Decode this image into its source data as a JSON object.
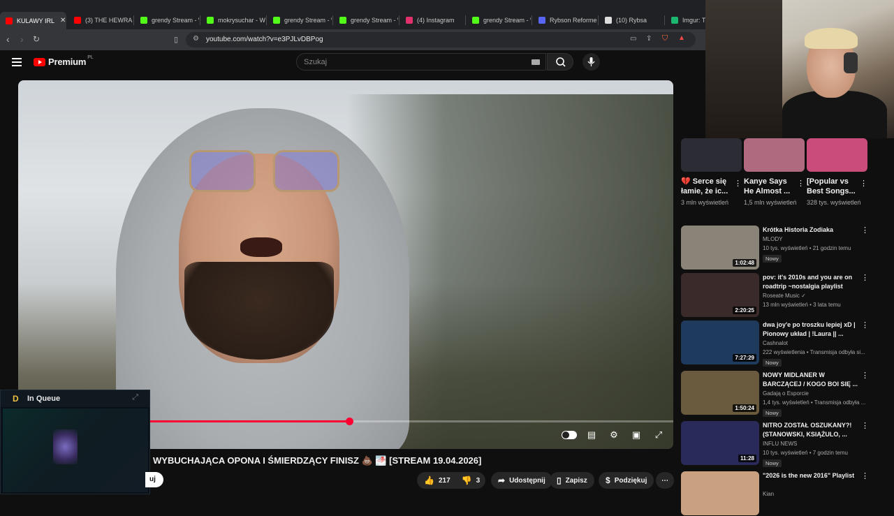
{
  "browser": {
    "tabs": [
      {
        "label": "KULAWY IRL",
        "active": true,
        "color": "#ff0000"
      },
      {
        "label": "(3) THE HEWRA",
        "active": false,
        "color": "#ff0000"
      },
      {
        "label": "grendy Stream - \\",
        "active": false,
        "color": "#53fc18"
      },
      {
        "label": "mokrysuchar - W",
        "active": false,
        "color": "#53fc18"
      },
      {
        "label": "grendy Stream - \\",
        "active": false,
        "color": "#53fc18"
      },
      {
        "label": "grendy Stream - \\",
        "active": false,
        "color": "#53fc18"
      },
      {
        "label": "(4) Instagram",
        "active": false,
        "color": "#e1306c"
      },
      {
        "label": "grendy Stream - \\",
        "active": false,
        "color": "#53fc18"
      },
      {
        "label": "Rybson Reformer",
        "active": false,
        "color": "#5865f2"
      },
      {
        "label": "(10) Rybsa",
        "active": false,
        "color": "#dddddd"
      },
      {
        "label": "Imgur: The",
        "active": false,
        "color": "#1bb76e"
      }
    ],
    "url": "youtube.com/watch?v=e3PJLvDBPog"
  },
  "header": {
    "logo_text": "Premium",
    "logo_region": "PL",
    "search_placeholder": "Szukaj"
  },
  "video": {
    "progress_fraction": 0.505
  },
  "queue_overlay": {
    "title": "In Queue"
  },
  "title": "WYBUCHAJĄCA OPONA I ŚMIERDZĄCY FINISZ 💩 🌁 [STREAM 19.04.2026]",
  "actions": {
    "subscribe_fragment": "uj",
    "likes": "217",
    "dislikes": "3",
    "share": "Udostępnij",
    "save": "Zapisz",
    "thanks": "Podziękuj"
  },
  "shorts": [
    {
      "title": "💔 Serce się łamie, że ic...",
      "views": "3 mln wyświetleń",
      "thumb": "#2c2c34"
    },
    {
      "title": "Kanye Says He Almost ...",
      "views": "1,5 mln wyświetleń",
      "thumb": "#b06a80"
    },
    {
      "title": "[Popular vs Best Songs...",
      "views": "328 tys. wyświetleń",
      "thumb": "#c94c7a"
    }
  ],
  "related": [
    {
      "title": "Krótka Historia Zodiaka",
      "channel": "MLODY",
      "meta": "10 tys. wyświetleń • 21 godzin temu",
      "duration": "1:02:48",
      "badge": "Nowy",
      "thumb": "#8a8478"
    },
    {
      "title": "pov: it's 2010s and you are on roadtrip ~nostalgia playlist",
      "channel": "Roseate Music ✓",
      "meta": "13 mln wyświetleń • 3 lata temu",
      "duration": "2:20:25",
      "badge": "",
      "thumb": "#3a2a2a"
    },
    {
      "title": "dwa joy'e po troszku lepiej xD | Pionowy układ | !Laura || ...",
      "channel": "Cashnalot",
      "meta": "222 wyświetlenia • Transmisja odbyła si...",
      "duration": "7:27:29",
      "badge": "Nowy",
      "thumb": "#1e3a5c"
    },
    {
      "title": "NOWY MIDLANER W BARCZĄCEJ / KOGO BOI SIĘ ...",
      "channel": "Gadają o Esporcie",
      "meta": "1,4 tys. wyświetleń • Transmisja odbyła ...",
      "duration": "1:50:24",
      "badge": "Nowy",
      "thumb": "#6a5a3e"
    },
    {
      "title": "NITRO ZOSTAŁ OSZUKANY?! (STANOWSKI, KSIĄŻULO, ...",
      "channel": "INFLU NEWS",
      "meta": "10 tys. wyświetleń • 7 godzin temu",
      "duration": "11:28",
      "badge": "Nowy",
      "thumb": "#2a2a5a"
    },
    {
      "title": "\"2026 is the new 2016\" Playlist",
      "channel": "Kian",
      "meta": "",
      "duration": "",
      "badge": "",
      "thumb": "#c9a080"
    }
  ]
}
